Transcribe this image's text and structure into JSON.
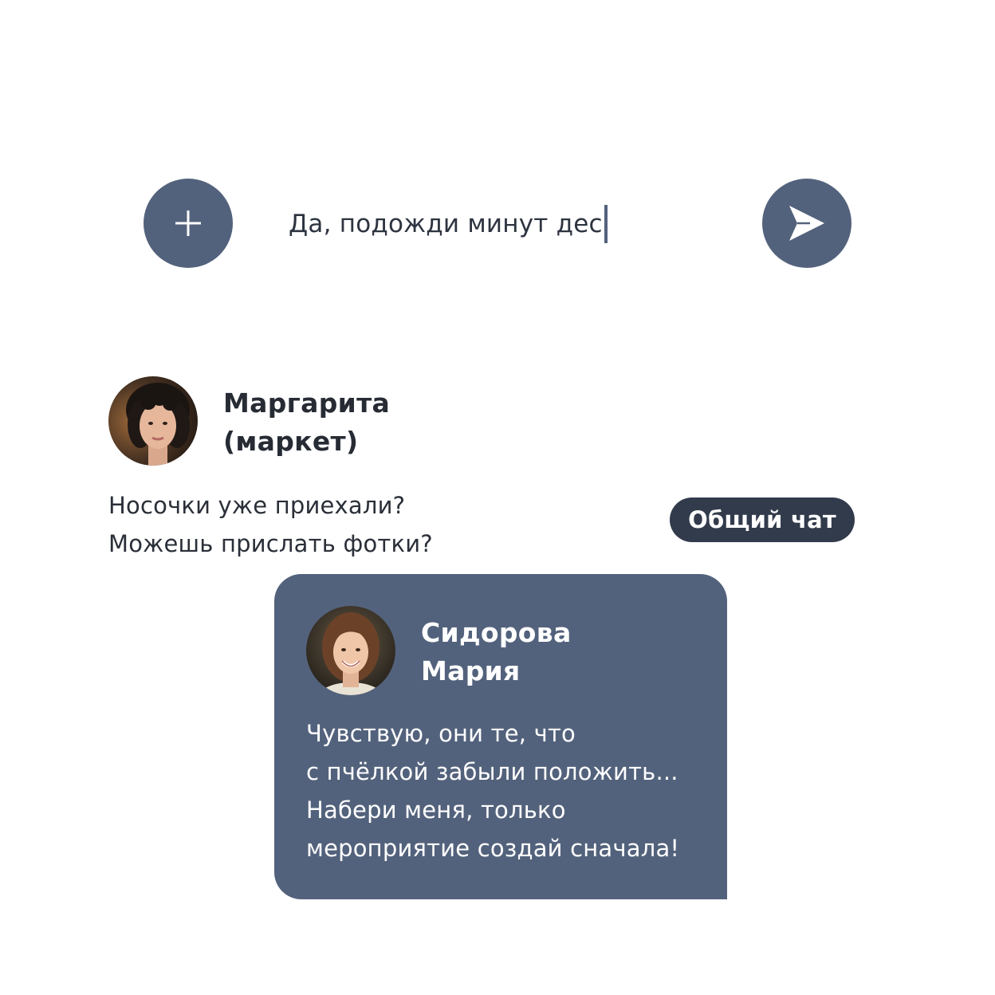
{
  "composer": {
    "input_value": "Да, подожди минут дес",
    "accent_color": "#53627c"
  },
  "icons": {
    "attach": "plus-icon",
    "send": "send-icon"
  },
  "message_1": {
    "sender_name_line1": "Маргарита",
    "sender_name_line2": "(маркет)",
    "text_line1": "Носочки уже приехали?",
    "text_line2": "Можешь прислать фотки?",
    "badge": "Общий чат"
  },
  "reply": {
    "sender_name_line1": "Сидорова",
    "sender_name_line2": "Мария",
    "text_line1": "Чувствую, они те, что",
    "text_line2": "с пчёлкой забыли положить...",
    "text_line3": "Набери меня, только",
    "text_line4": "мероприятие создай сначала!",
    "card_color": "#53627c"
  }
}
